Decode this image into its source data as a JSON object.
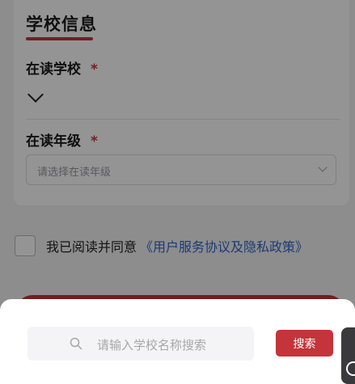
{
  "form": {
    "section_title": "学校信息",
    "school_field": {
      "label": "在读学校",
      "required_mark": "*"
    },
    "grade_field": {
      "label": "在读年级",
      "required_mark": "*",
      "placeholder": "请选择在读年级"
    },
    "agreement": {
      "text": "我已阅读并同意",
      "link": "《用户服务协议及隐私政策》",
      "checked": false
    }
  },
  "search_sheet": {
    "placeholder": "请输入学校名称搜索",
    "search_button_label": "搜索"
  },
  "colors": {
    "accent": "#c4343a",
    "link": "#2f66c8"
  }
}
